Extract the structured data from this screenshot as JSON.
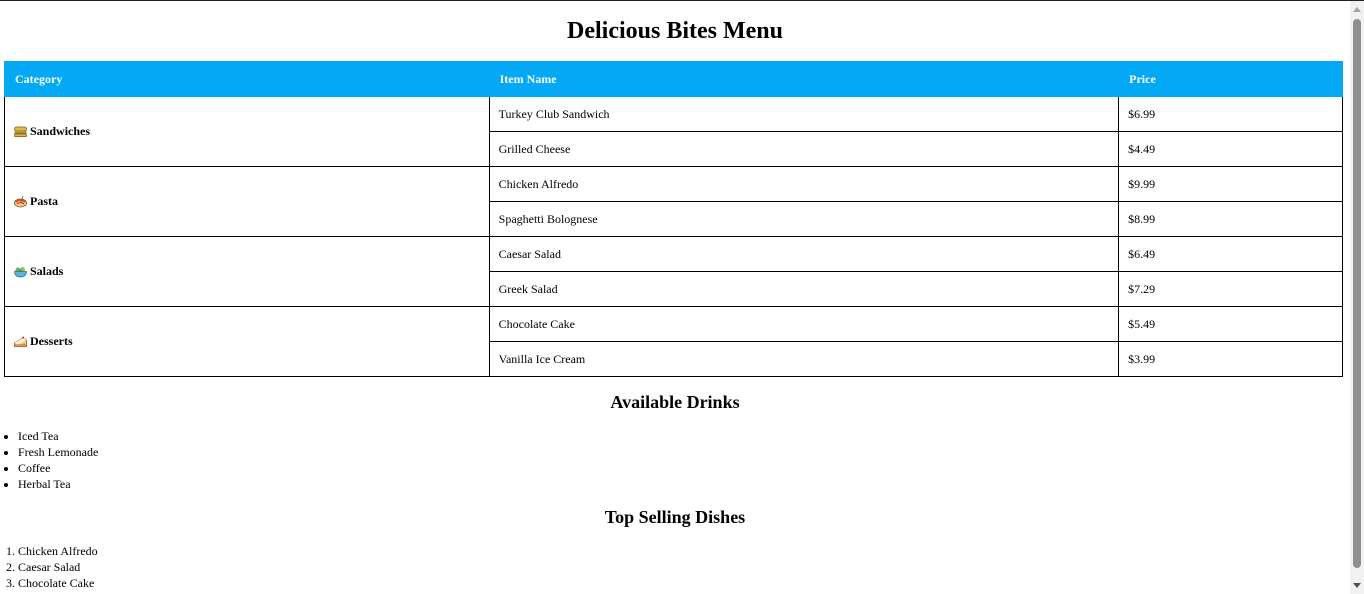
{
  "page": {
    "title": "Delicious Bites Menu"
  },
  "menu_table": {
    "headers": [
      "Category",
      "Item Name",
      "Price"
    ],
    "categories": [
      {
        "name": "Sandwiches",
        "icon": "sandwich-icon",
        "items": [
          {
            "name": "Turkey Club Sandwich",
            "price": "$6.99"
          },
          {
            "name": "Grilled Cheese",
            "price": "$4.49"
          }
        ]
      },
      {
        "name": "Pasta",
        "icon": "pasta-icon",
        "items": [
          {
            "name": "Chicken Alfredo",
            "price": "$9.99"
          },
          {
            "name": "Spaghetti Bolognese",
            "price": "$8.99"
          }
        ]
      },
      {
        "name": "Salads",
        "icon": "salad-icon",
        "items": [
          {
            "name": "Caesar Salad",
            "price": "$6.49"
          },
          {
            "name": "Greek Salad",
            "price": "$7.29"
          }
        ]
      },
      {
        "name": "Desserts",
        "icon": "cake-icon",
        "items": [
          {
            "name": "Chocolate Cake",
            "price": "$5.49"
          },
          {
            "name": "Vanilla Ice Cream",
            "price": "$3.99"
          }
        ]
      }
    ]
  },
  "drinks": {
    "heading": "Available Drinks",
    "items": [
      "Iced Tea",
      "Fresh Lemonade",
      "Coffee",
      "Herbal Tea"
    ]
  },
  "top_selling": {
    "heading": "Top Selling Dishes",
    "items": [
      "Chicken Alfredo",
      "Caesar Salad",
      "Chocolate Cake"
    ]
  },
  "colors": {
    "header_bg": "#03a9f4",
    "header_text": "#ffffff"
  }
}
